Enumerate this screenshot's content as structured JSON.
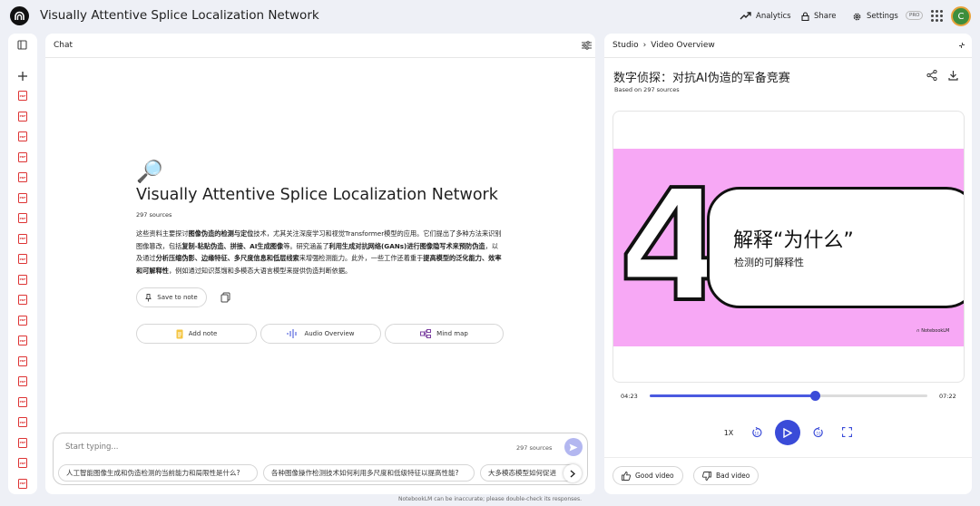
{
  "app": {
    "title": "Visually Attentive Splice Localization Network",
    "analytics_label": "Analytics",
    "share_label": "Share",
    "settings_label": "Settings",
    "pro_badge": "PRO",
    "avatar_initial": "C"
  },
  "sources": {
    "item_label": "PDF",
    "item_count": 20
  },
  "chat": {
    "header": "Chat",
    "notebook_title": "Visually Attentive Splice Localization Network",
    "source_count": "297 sources",
    "summary_parts": [
      {
        "t": "这些资料主要探讨",
        "b": false
      },
      {
        "t": "图像伪造的检测与定位",
        "b": true
      },
      {
        "t": "技术，尤其关注深度学习和视觉Transformer模型的应用。它们提出了多种方法来识别图像篡改，包括",
        "b": false
      },
      {
        "t": "复制-粘贴伪造、拼接、AI生成图像",
        "b": true
      },
      {
        "t": "等。研究涵盖了",
        "b": false
      },
      {
        "t": "利用生成对抗网络(GANs)进行图像隐写术来预防伪造",
        "b": true
      },
      {
        "t": "，以及通过",
        "b": false
      },
      {
        "t": "分析压缩伪影、边缘特征、多尺度信息和低层线索",
        "b": true
      },
      {
        "t": "来增强检测能力。此外，一些工作还着重于",
        "b": false
      },
      {
        "t": "提高模型的泛化能力、效率和可解释性",
        "b": true
      },
      {
        "t": "，例如通过知识蒸馏和多模态大语言模型来提供伪造判断依据。",
        "b": false
      }
    ],
    "save_to_note": "Save to note",
    "add_note": "Add note",
    "audio_overview": "Audio Overview",
    "mind_map": "Mind map",
    "input_placeholder": "Start typing...",
    "input_source_count": "297 sources",
    "suggestions": [
      "人工智能图像生成和伪造检测的当前能力和局限性是什么?",
      "各种图像操作检测技术如何利用多尺度和低级特征以提高性能?",
      "大多模态模型如何促进"
    ]
  },
  "studio": {
    "breadcrumb_root": "Studio",
    "breadcrumb_separator": "›",
    "breadcrumb_current": "Video Overview",
    "video_title": "数字侦探：对抗AI伪造的军备竞赛",
    "based_on": "Based on 297 sources",
    "slide": {
      "number": "4",
      "title": "解释“为什么”",
      "subtitle": "检测的可解释性",
      "watermark": "NotebookLM",
      "bg_color": "#f7a8f5"
    },
    "current_time": "04:23",
    "total_time": "07:22",
    "progress": 0.595,
    "speed": "1X",
    "good_video": "Good video",
    "bad_video": "Bad video"
  },
  "footer": {
    "disclaimer": "NotebookLM can be inaccurate; please double-check its responses."
  }
}
